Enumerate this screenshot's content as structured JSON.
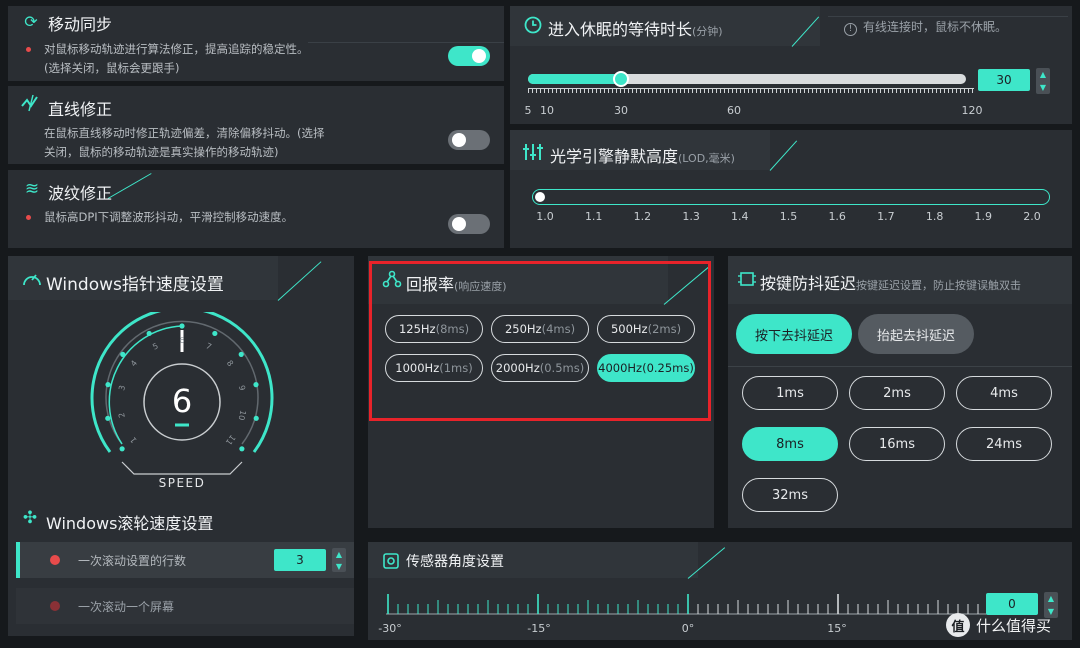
{
  "motion_sync": {
    "title": "移动同步",
    "desc": "对鼠标移动轨迹进行算法修正，提高追踪的稳定性。(选择关闭，鼠标会更跟手)",
    "enabled": true
  },
  "angle_snap": {
    "title": "直线修正",
    "desc": "在鼠标直线移动时修正轨迹偏差，清除偏移抖动。(选择关闭，鼠标的移动轨迹是真实操作的移动轨迹)",
    "enabled": false
  },
  "ripple": {
    "title": "波纹修正",
    "desc": "鼠标高DPI下调整波形抖动，平滑控制移动速度。",
    "enabled": false
  },
  "sleep": {
    "title": "进入休眠的等待时长",
    "unit": "(分钟)",
    "note": "有线连接时，鼠标不休眠。",
    "value": "30",
    "min": 5,
    "max": 120,
    "ticks": [
      "5",
      "10",
      "30",
      "60",
      "120"
    ]
  },
  "lod": {
    "title": "光学引擎静默高度",
    "unit": "(LOD,毫米)",
    "value": 1.0,
    "ticks": [
      "1.0",
      "1.1",
      "1.2",
      "1.3",
      "1.4",
      "1.5",
      "1.6",
      "1.7",
      "1.8",
      "1.9",
      "2.0"
    ]
  },
  "pointer_speed": {
    "title": "Windows指针速度设置",
    "value": "6",
    "speed_label": "SPEED",
    "dial_numbers": [
      "1",
      "2",
      "3",
      "4",
      "5",
      "6",
      "7",
      "8",
      "9",
      "10",
      "11"
    ]
  },
  "scroll_speed": {
    "title": "Windows滚轮速度设置",
    "option_lines": "一次滚动设置的行数",
    "lines_value": "3",
    "option_screen": "一次滚动一个屏幕"
  },
  "polling": {
    "title": "回报率",
    "sub": "(响应速度)",
    "options": [
      {
        "hz": "125Hz",
        "ms": "(8ms)"
      },
      {
        "hz": "250Hz",
        "ms": "(4ms)"
      },
      {
        "hz": "500Hz",
        "ms": "(2ms)"
      },
      {
        "hz": "1000Hz",
        "ms": "(1ms)"
      },
      {
        "hz": "2000Hz",
        "ms": "(0.5ms)"
      },
      {
        "hz": "4000Hz",
        "ms": "(0.25ms)"
      }
    ],
    "selected": "4000Hz"
  },
  "debounce": {
    "title": "按键防抖延迟",
    "sub": "按键延迟设置，防止按键误触双击",
    "tab_press": "按下去抖延迟",
    "tab_release": "抬起去抖延迟",
    "options": [
      "1ms",
      "2ms",
      "4ms",
      "8ms",
      "16ms",
      "24ms",
      "32ms"
    ],
    "selected": "8ms"
  },
  "sensor_angle": {
    "title": "传感器角度设置",
    "value": "0",
    "ticks": [
      "-30°",
      "-15°",
      "0°",
      "15°"
    ]
  },
  "watermark": {
    "text": "什么值得买",
    "logo": "值"
  },
  "colors": {
    "accent": "#3ee6c9",
    "highlight_border": "#e8232a",
    "panel": "#2a2e33",
    "background": "#16191c"
  },
  "icons": [
    "refresh-icon",
    "line-fix-icon",
    "wave-icon",
    "clock-icon",
    "info-icon",
    "sliders-icon",
    "gauge-icon",
    "scroll-icon",
    "network-icon",
    "chip-icon",
    "sensor-icon"
  ]
}
